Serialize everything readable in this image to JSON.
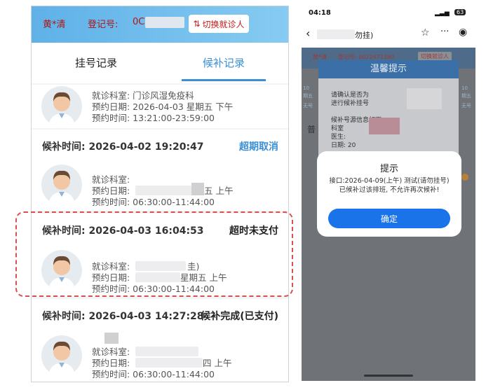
{
  "left": {
    "header": {
      "patient_name": "黄*清",
      "reg_label": "登记号:",
      "reg_number": "0C",
      "switch_label": "切换就诊人"
    },
    "tabs": [
      "挂号记录",
      "候补记录"
    ],
    "card0": {
      "dept": "就诊科室:  门诊风湿免疫科",
      "date": "预约日期:  2026-04-03 星期五 下午",
      "time": "预约时间:  13:21:00-23:59:00"
    },
    "card1": {
      "waitlist_time": "候补时间: 2026-04-02 19:20:47",
      "status": "超期取消",
      "dept": "就诊科室:",
      "date": "预约日期:",
      "date_tail": "五 上午",
      "time": "预约时间:  06:30:00-11:44:00"
    },
    "card2": {
      "waitlist_time": "候补时间: 2026-04-03 16:04:53",
      "status": "超时未支付",
      "dept": "就诊科室:",
      "dept_tail": "圭)",
      "date": "预约日期:",
      "date_tail": "星期五 上午",
      "time": "预约时间:  06:30:00-11:44:00"
    },
    "card3": {
      "waitlist_time": "候补时间: 2026-04-03 14:27:28",
      "status": "候补完成(已支付)",
      "dept": "就诊科室:",
      "date": "预约日期:",
      "date_tail": "四 上午",
      "time": "预约时间:  06:30:00-11:44:00"
    }
  },
  "right": {
    "statusbar": {
      "time": "04:18",
      "battery": "63"
    },
    "navbar": {
      "title_tail": "勿挂)"
    },
    "background_header": {
      "name": "黄*清",
      "reg": "登记号: 0022471380",
      "switch": "切换就诊人"
    },
    "warm_dialog": {
      "title": "温馨提示",
      "line1": "请确认是否为",
      "line2": "进行候补挂号",
      "line3": "候补号源信息如下",
      "line4": "科室",
      "line5": "医生:",
      "line6": "日期:  20"
    },
    "bg_left_text": {
      "d1": "10",
      "d2": "期五",
      "d3": "无号",
      "section": "普"
    },
    "bg_right_text": {
      "d1": "10",
      "d2": "期五",
      "d3": "无号"
    },
    "dialog": {
      "title": "提示",
      "message1": "接口:2026-04-09(上午) 测试(请勿挂号)",
      "message2": "已候补过该排班, 不允许再次候补!",
      "ok": "确定"
    }
  },
  "colors": {
    "accent_blue": "#3a8fd6",
    "header_red": "#b01515",
    "highlight_red": "#d9504e",
    "dialog_button": "#1a73e8"
  }
}
